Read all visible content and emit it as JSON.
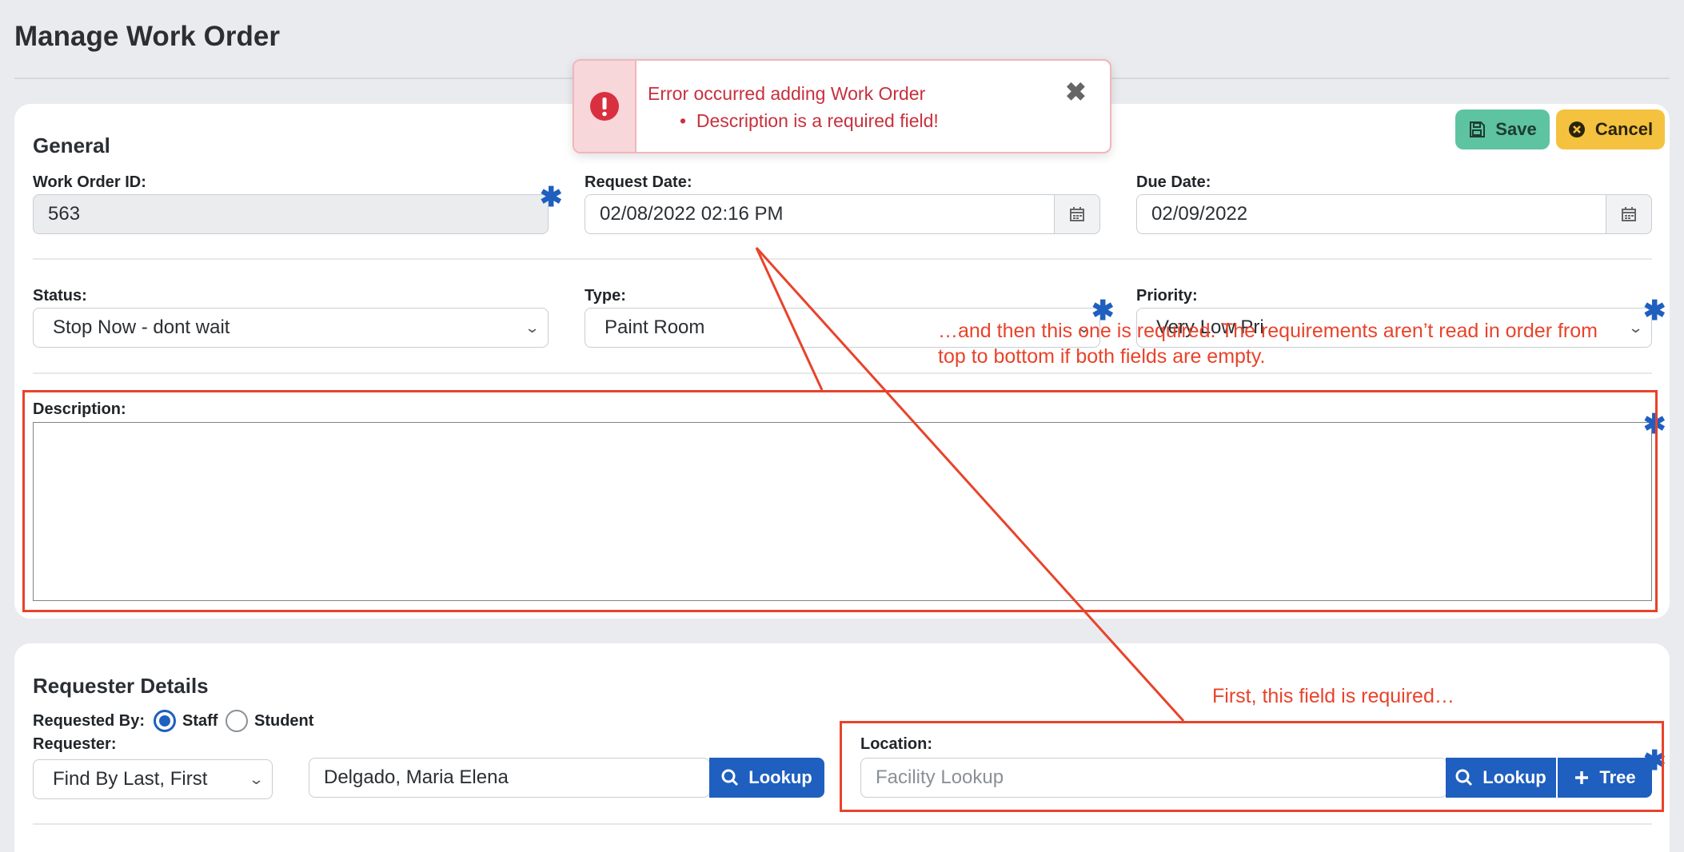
{
  "page": {
    "title": "Manage Work Order"
  },
  "toast": {
    "title": "Error occurred adding Work Order",
    "items": [
      "Description is a required field!"
    ]
  },
  "toolbar": {
    "save_label": "Save",
    "cancel_label": "Cancel"
  },
  "general": {
    "title": "General",
    "work_order_id": {
      "label": "Work Order ID:",
      "value": "563"
    },
    "request_date": {
      "label": "Request Date:",
      "value": "02/08/2022 02:16 PM"
    },
    "due_date": {
      "label": "Due Date:",
      "value": "02/09/2022"
    },
    "status": {
      "label": "Status:",
      "value": "Stop Now - dont wait"
    },
    "type": {
      "label": "Type:",
      "value": "Paint Room"
    },
    "priority": {
      "label": "Priority:",
      "value": "Very Low Pri"
    },
    "description": {
      "label": "Description:",
      "value": ""
    }
  },
  "requester": {
    "title": "Requester Details",
    "requested_by_label": "Requested By:",
    "options": [
      "Staff",
      "Student"
    ],
    "selected": "Staff",
    "requester_label": "Requester:",
    "find_by": "Find By Last, First",
    "requester_value": "Delgado, Maria Elena",
    "lookup_label": "Lookup",
    "location_label": "Location:",
    "location_placeholder": "Facility Lookup",
    "tree_label": "Tree"
  },
  "annotations": {
    "note_description": "…and then this one is required. The requirements aren’t read in order from top to bottom if both fields are empty.",
    "note_location": "First, this field is required…"
  },
  "colors": {
    "accent": "#1f5fbf",
    "save": "#5ec3a0",
    "cancel": "#f4c23e",
    "error": "#c7303d",
    "annotation": "#e8432b"
  }
}
